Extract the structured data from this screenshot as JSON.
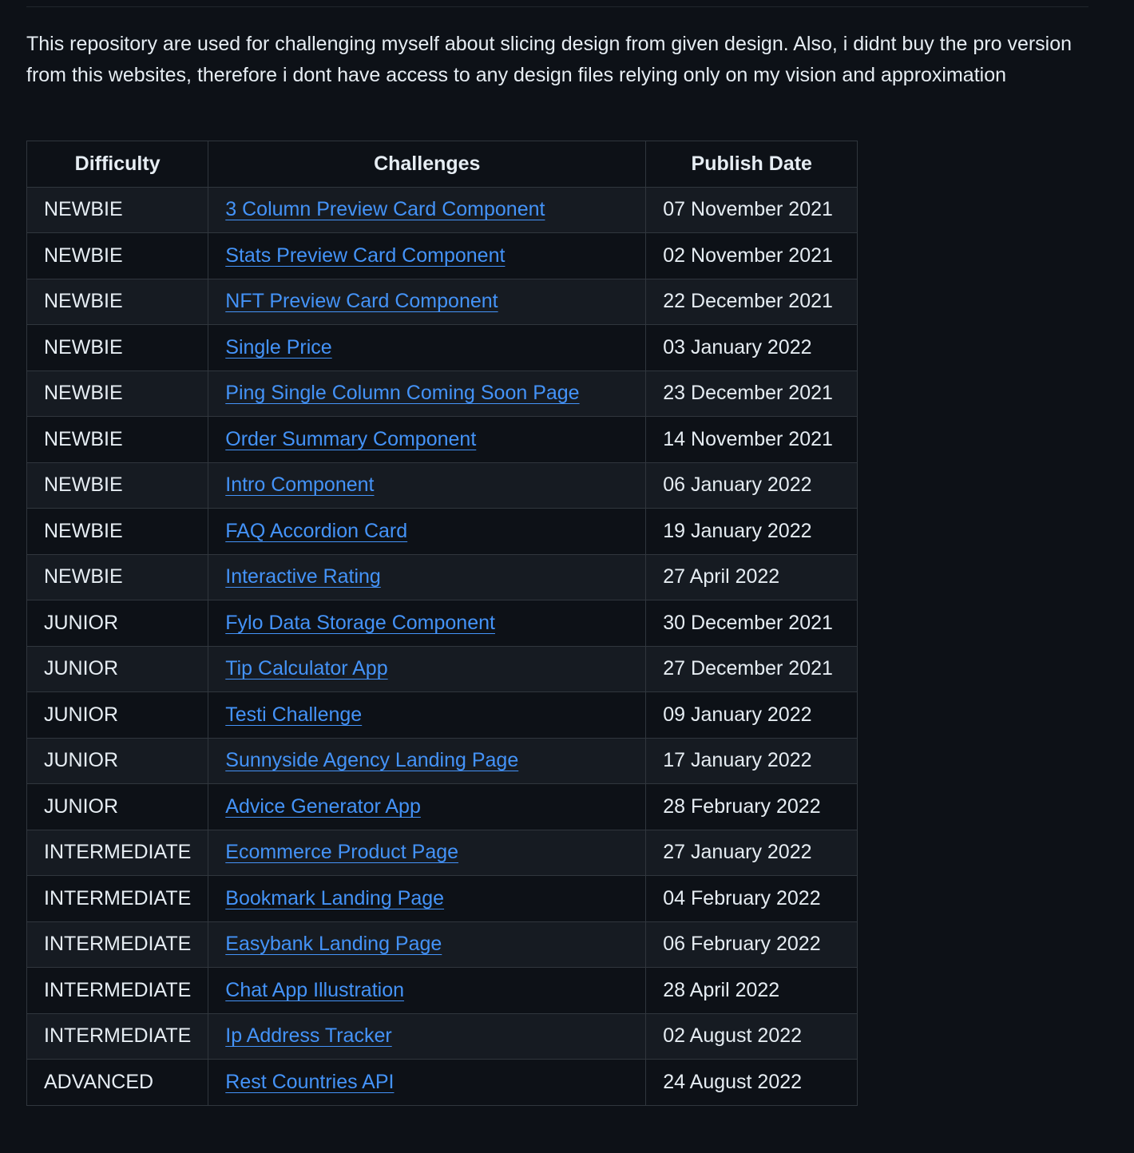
{
  "description": "This repository are used for challenging myself about slicing design from given design. Also, i didnt buy the pro version from this websites, therefore i dont have access to any design files relying only on my vision and approximation",
  "table": {
    "headers": [
      "Difficulty",
      "Challenges",
      "Publish Date"
    ],
    "rows": [
      {
        "difficulty": "NEWBIE",
        "challenge": "3 Column Preview Card Component",
        "date": "07 November 2021"
      },
      {
        "difficulty": "NEWBIE",
        "challenge": "Stats Preview Card Component",
        "date": "02 November 2021"
      },
      {
        "difficulty": "NEWBIE",
        "challenge": "NFT Preview Card Component",
        "date": "22 December 2021"
      },
      {
        "difficulty": "NEWBIE",
        "challenge": "Single Price",
        "date": "03 January 2022"
      },
      {
        "difficulty": "NEWBIE",
        "challenge": "Ping Single Column Coming Soon Page",
        "date": "23 December 2021"
      },
      {
        "difficulty": "NEWBIE",
        "challenge": "Order Summary Component",
        "date": "14 November 2021"
      },
      {
        "difficulty": "NEWBIE",
        "challenge": "Intro Component",
        "date": "06 January 2022"
      },
      {
        "difficulty": "NEWBIE",
        "challenge": "FAQ Accordion Card",
        "date": "19 January 2022"
      },
      {
        "difficulty": "NEWBIE",
        "challenge": "Interactive Rating",
        "date": "27 April 2022"
      },
      {
        "difficulty": "JUNIOR",
        "challenge": "Fylo Data Storage Component",
        "date": "30 December 2021"
      },
      {
        "difficulty": "JUNIOR",
        "challenge": "Tip Calculator App",
        "date": "27 December 2021"
      },
      {
        "difficulty": "JUNIOR",
        "challenge": "Testi Challenge",
        "date": "09 January 2022"
      },
      {
        "difficulty": "JUNIOR",
        "challenge": "Sunnyside Agency Landing Page",
        "date": "17 January 2022"
      },
      {
        "difficulty": "JUNIOR",
        "challenge": "Advice Generator App",
        "date": "28 February 2022"
      },
      {
        "difficulty": "INTERMEDIATE",
        "challenge": "Ecommerce Product Page",
        "date": "27 January 2022"
      },
      {
        "difficulty": "INTERMEDIATE",
        "challenge": "Bookmark Landing Page",
        "date": "04 February 2022"
      },
      {
        "difficulty": "INTERMEDIATE",
        "challenge": "Easybank Landing Page",
        "date": "06 February 2022"
      },
      {
        "difficulty": "INTERMEDIATE",
        "challenge": "Chat App Illustration",
        "date": "28 April 2022"
      },
      {
        "difficulty": "INTERMEDIATE",
        "challenge": "Ip Address Tracker",
        "date": "02 August 2022"
      },
      {
        "difficulty": "ADVANCED",
        "challenge": "Rest Countries API",
        "date": "24 August 2022"
      }
    ]
  },
  "colors": {
    "background": "#0d1117",
    "row_alt": "#161b22",
    "border": "#30363d",
    "text": "#e6edf3",
    "link": "#4493f8"
  }
}
